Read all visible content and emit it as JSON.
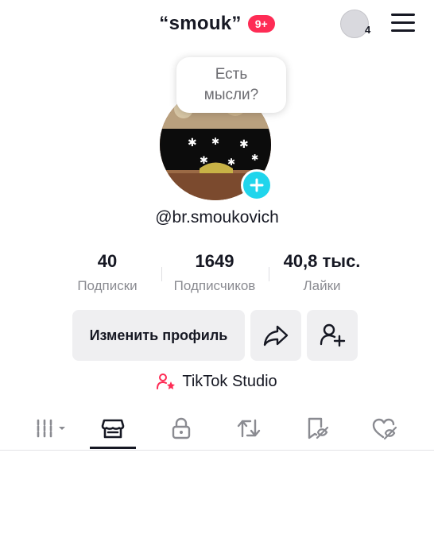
{
  "header": {
    "title": "“smouk”",
    "notifications_badge": "9+",
    "friends_count": "4"
  },
  "profile": {
    "thought_bubble": "Есть мысли?",
    "username": "@br.smoukovich"
  },
  "stats": [
    {
      "value": "40",
      "label": "Подписки"
    },
    {
      "value": "1649",
      "label": "Подписчиков"
    },
    {
      "value": "40,8 тыс.",
      "label": "Лайки"
    }
  ],
  "buttons": {
    "edit_profile": "Изменить профиль"
  },
  "studio": {
    "label": "TikTok Studio"
  },
  "tabs": [
    {
      "icon": "grid-icon"
    },
    {
      "icon": "shop-icon",
      "active": true
    },
    {
      "icon": "lock-icon"
    },
    {
      "icon": "repost-icon"
    },
    {
      "icon": "bookmark-icon"
    },
    {
      "icon": "liked-icon"
    }
  ],
  "colors": {
    "accent_red": "#fe2c55",
    "accent_cyan": "#20d5ec",
    "text_primary": "#161823",
    "text_secondary": "#8a8b91"
  }
}
